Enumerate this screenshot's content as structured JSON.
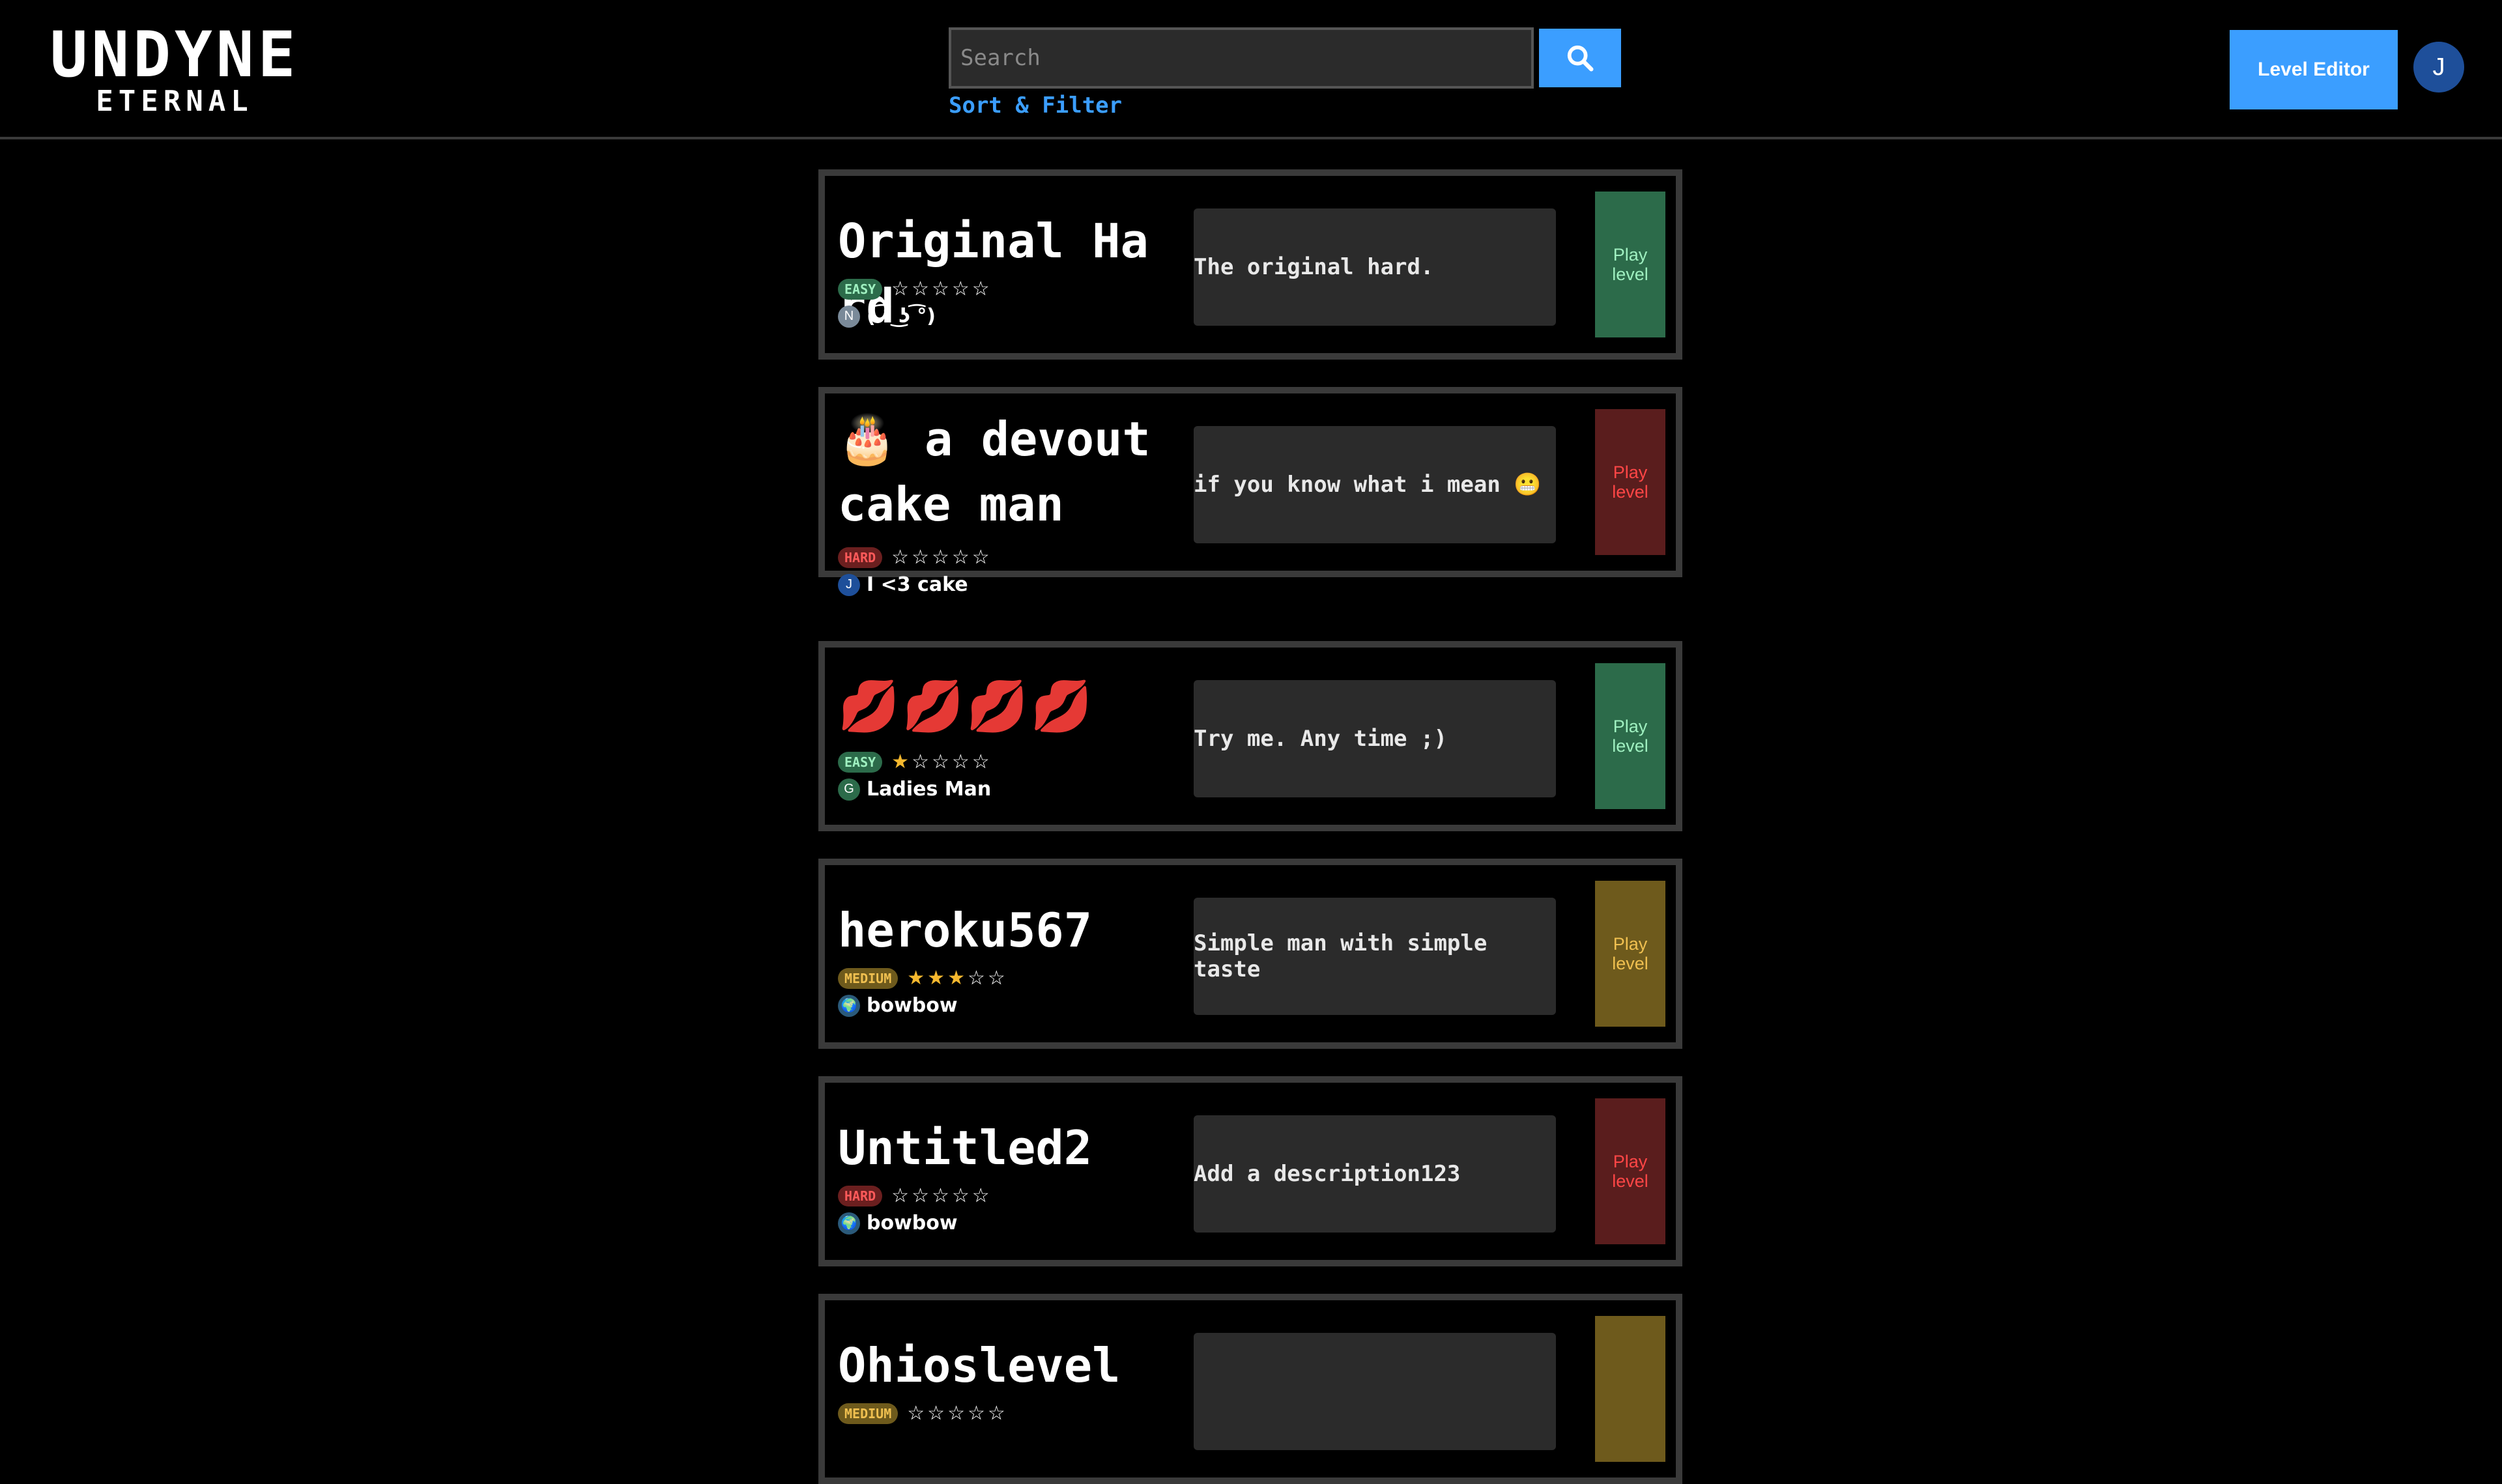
{
  "header": {
    "logo_top": "UNDYNE",
    "logo_bottom": "ETERNAL",
    "search_placeholder": "Search",
    "search_value": "",
    "sort_filter_label": "Sort & Filter",
    "level_editor_label": "Level Editor",
    "user_initial": "J"
  },
  "colors": {
    "accent": "#3b9eff",
    "easy": "#2c6b4a",
    "hard": "#6b1f1f",
    "medium": "#6e5a1c",
    "star": "#f5b82e"
  },
  "levels": [
    {
      "title": "Original Hard",
      "difficulty": "EASY",
      "rating": 0,
      "author_initial": "N",
      "author_name": "( ͡° ͜ʖ ͡°)",
      "description": "The original hard.",
      "play_label_1": "Play",
      "play_label_2": "level"
    },
    {
      "title": "🎂 a devout cake man",
      "difficulty": "HARD",
      "rating": 0,
      "author_initial": "J",
      "author_name": "I <3 cake",
      "description": "if you know what i mean 😬",
      "play_label_1": "Play",
      "play_label_2": "level"
    },
    {
      "title": "💋💋💋💋",
      "difficulty": "EASY",
      "rating": 1,
      "author_initial": "G",
      "author_name": "Ladies Man",
      "description": "Try me. Any time ;)",
      "play_label_1": "Play",
      "play_label_2": "level"
    },
    {
      "title": "heroku567",
      "difficulty": "MEDIUM",
      "rating": 3,
      "author_initial": "🌍",
      "author_name": "bowbow",
      "description": "Simple man with simple taste",
      "play_label_1": "Play",
      "play_label_2": "level"
    },
    {
      "title": "Untitled2",
      "difficulty": "HARD",
      "rating": 0,
      "author_initial": "🌍",
      "author_name": "bowbow",
      "description": "Add a description123",
      "play_label_1": "Play",
      "play_label_2": "level"
    },
    {
      "title": "Ohioslevel",
      "difficulty": "MEDIUM",
      "rating": 0,
      "author_initial": "",
      "author_name": "",
      "description": "",
      "play_label_1": "",
      "play_label_2": ""
    }
  ]
}
